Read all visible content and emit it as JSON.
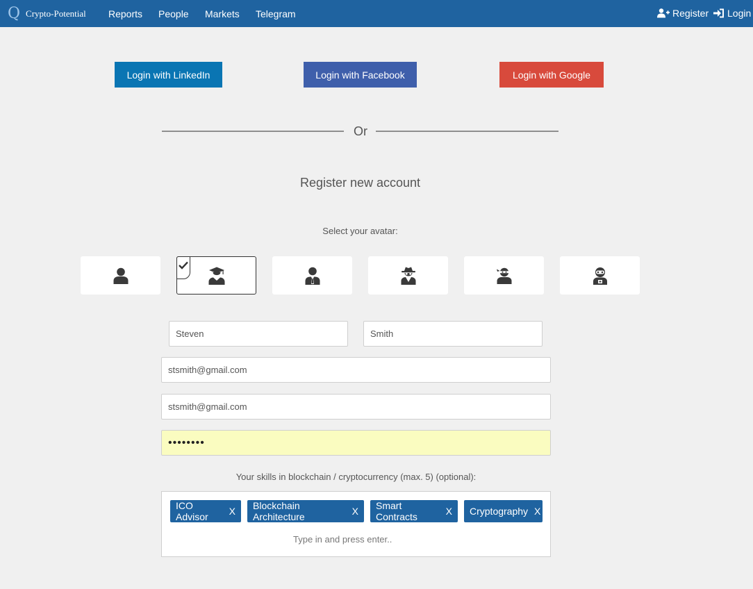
{
  "navbar": {
    "brand_logo": "Q",
    "brand_text": "Crypto-Potential",
    "links": [
      "Reports",
      "People",
      "Markets",
      "Telegram"
    ],
    "register": "Register",
    "login": "Login",
    "background": "#1f63a0"
  },
  "social": {
    "linkedin": {
      "label": "Login with LinkedIn",
      "color": "#0a75b3"
    },
    "facebook": {
      "label": "Login with Facebook",
      "color": "#3f5fab"
    },
    "google": {
      "label": "Login with Google",
      "color": "#d84a3c"
    }
  },
  "divider_text": "Or",
  "title": "Register new account",
  "avatar_label": "Select your avatar:",
  "avatars": [
    {
      "icon": "user-icon",
      "selected": false
    },
    {
      "icon": "graduate-icon",
      "selected": true
    },
    {
      "icon": "businessman-icon",
      "selected": false
    },
    {
      "icon": "spy-icon",
      "selected": false
    },
    {
      "icon": "ninja-icon",
      "selected": false
    },
    {
      "icon": "robot-icon",
      "selected": false
    }
  ],
  "form": {
    "first_name": "Steven",
    "last_name": "Smith",
    "email": "stsmith@gmail.com",
    "email_confirm": "stsmith@gmail.com",
    "password": "••••••••"
  },
  "skills": {
    "label": "Your skills in blockchain / cryptocurrency (max. 5) (optional):",
    "tags": [
      "ICO Advisor",
      "Blockchain Architecture",
      "Smart Contracts",
      "Cryptography"
    ],
    "remove": "X",
    "placeholder": "Type in and press enter.."
  }
}
